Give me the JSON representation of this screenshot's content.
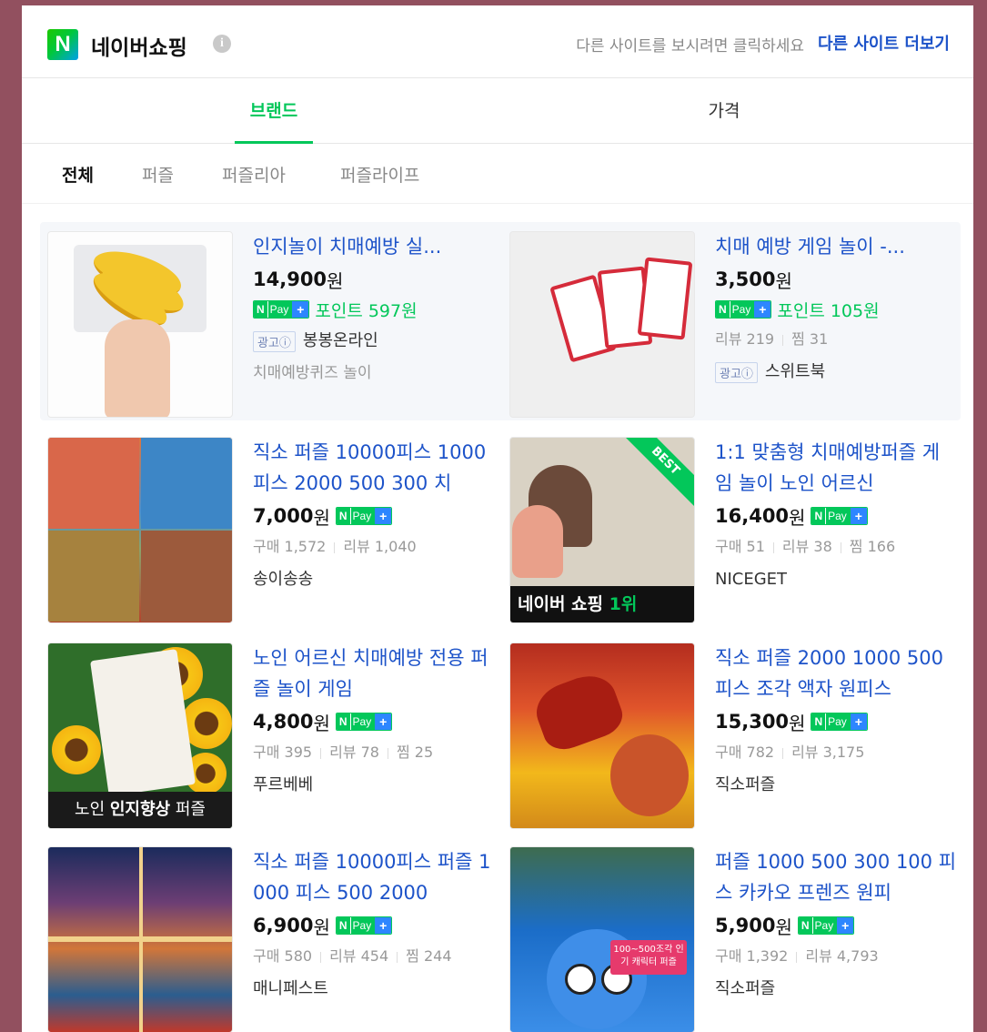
{
  "header": {
    "logo_letter": "N",
    "title": "네이버쇼핑",
    "info_glyph": "i",
    "hint": "다른 사이트를 보시려면 클릭하세요",
    "more_link": "다른 사이트 더보기"
  },
  "tabs": [
    {
      "label": "브랜드",
      "active": true
    },
    {
      "label": "가격",
      "active": false
    }
  ],
  "filters": [
    {
      "label": "전체",
      "active": true
    },
    {
      "label": "퍼즐",
      "active": false
    },
    {
      "label": "퍼즐리아",
      "active": false
    },
    {
      "label": "퍼즐라이프",
      "active": false
    }
  ],
  "npay": {
    "n": "N",
    "pay": "Pay",
    "plus": "+"
  },
  "products": [
    {
      "title": "인지놀이 치매예방 실...",
      "price": "14,900",
      "unit": "원",
      "point": "포인트 597원",
      "ad_label": "광고ⓘ",
      "seller": "봉봉온라인",
      "sub": "치매예방퀴즈 놀이"
    },
    {
      "title": "치매 예방 게임 놀이 -...",
      "price": "3,500",
      "unit": "원",
      "point": "포인트 105원",
      "meta": [
        "리뷰 219",
        "찜 31"
      ],
      "ad_label": "광고ⓘ",
      "seller": "스위트북"
    },
    {
      "title": "직소 퍼즐 10000피스 1000 피스 2000 500 300 치",
      "price": "7,000",
      "unit": "원",
      "meta": [
        "구매 1,572",
        "리뷰 1,040"
      ],
      "seller": "송이송송"
    },
    {
      "title": "1:1 맞춤형 치매예방퍼즐 게임 놀이 노인 어르신",
      "price": "16,400",
      "unit": "원",
      "meta": [
        "구매 51",
        "리뷰 38",
        "찜 166"
      ],
      "seller": "NICEGET",
      "thumb_banner": "네이버 쇼핑",
      "thumb_rank": "1위",
      "thumb_best": "BEST"
    },
    {
      "title": "노인 어르신 치매예방 전용 퍼즐 놀이 게임",
      "price": "4,800",
      "unit": "원",
      "meta": [
        "구매 395",
        "리뷰 78",
        "찜 25"
      ],
      "seller": "푸르베베",
      "thumb_banner_a": "노인 ",
      "thumb_banner_b": "인지향상",
      "thumb_banner_c": " 퍼즐"
    },
    {
      "title": "직소 퍼즐 2000 1000 500피스 조각 액자 원피스",
      "price": "15,300",
      "unit": "원",
      "meta": [
        "구매 782",
        "리뷰 3,175"
      ],
      "seller": "직소퍼즐"
    },
    {
      "title": "직소 퍼즐 10000피스 퍼즐 1000 피스 500 2000",
      "price": "6,900",
      "unit": "원",
      "meta": [
        "구매 580",
        "리뷰 454",
        "찜 244"
      ],
      "seller": "매니페스트"
    },
    {
      "title": "퍼즐 1000 500 300 100 피스 카카오 프렌즈 원피",
      "price": "5,900",
      "unit": "원",
      "meta": [
        "구매 1,392",
        "리뷰 4,793"
      ],
      "seller": "직소퍼즐",
      "thumb_tag": "100~500조각 인기 캐릭터 퍼즐"
    }
  ]
}
